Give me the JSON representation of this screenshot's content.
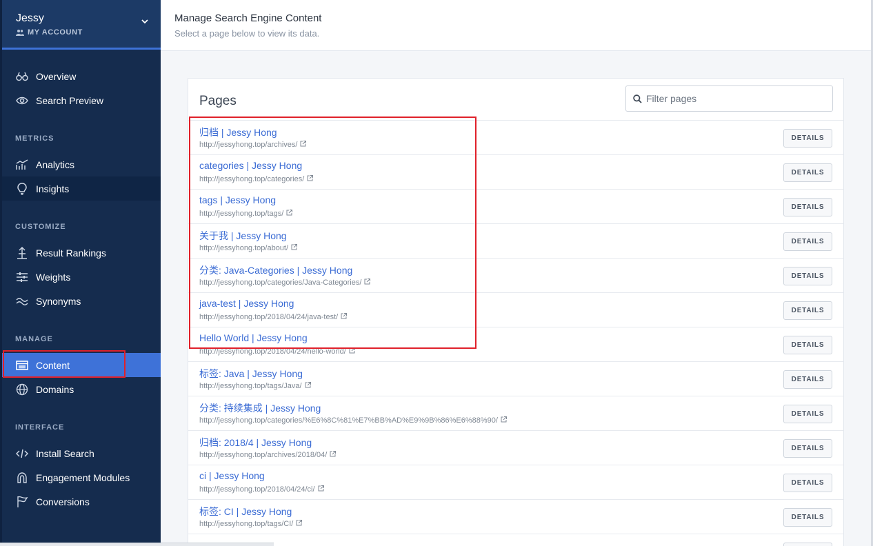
{
  "account": {
    "name": "Jessy",
    "label": "MY ACCOUNT"
  },
  "nav": {
    "overview": "Overview",
    "search_preview": "Search Preview",
    "metrics_header": "METRICS",
    "analytics": "Analytics",
    "insights": "Insights",
    "customize_header": "CUSTOMIZE",
    "result_rankings": "Result Rankings",
    "weights": "Weights",
    "synonyms": "Synonyms",
    "manage_header": "MANAGE",
    "content": "Content",
    "domains": "Domains",
    "interface_header": "INTERFACE",
    "install_search": "Install Search",
    "engagement_modules": "Engagement Modules",
    "conversions": "Conversions"
  },
  "header": {
    "title": "Manage Search Engine Content",
    "subtitle": "Select a page below to view its data."
  },
  "pages": {
    "title": "Pages",
    "filter_placeholder": "Filter pages",
    "details_label": "DETAILS",
    "rows": [
      {
        "title": "归档 | Jessy Hong",
        "url": "http://jessyhong.top/archives/"
      },
      {
        "title": "categories | Jessy Hong",
        "url": "http://jessyhong.top/categories/"
      },
      {
        "title": "tags | Jessy Hong",
        "url": "http://jessyhong.top/tags/"
      },
      {
        "title": "关于我 | Jessy Hong",
        "url": "http://jessyhong.top/about/"
      },
      {
        "title": "分类: Java-Categories | Jessy Hong",
        "url": "http://jessyhong.top/categories/Java-Categories/"
      },
      {
        "title": "java-test | Jessy Hong",
        "url": "http://jessyhong.top/2018/04/24/java-test/"
      },
      {
        "title": "Hello World | Jessy Hong",
        "url": "http://jessyhong.top/2018/04/24/hello-world/"
      },
      {
        "title": "标签: Java | Jessy Hong",
        "url": "http://jessyhong.top/tags/Java/"
      },
      {
        "title": "分类: 持续集成 | Jessy Hong",
        "url": "http://jessyhong.top/categories/%E6%8C%81%E7%BB%AD%E9%9B%86%E6%88%90/"
      },
      {
        "title": "归档: 2018/4 | Jessy Hong",
        "url": "http://jessyhong.top/archives/2018/04/"
      },
      {
        "title": "ci | Jessy Hong",
        "url": "http://jessyhong.top/2018/04/24/ci/"
      },
      {
        "title": "标签: CI | Jessy Hong",
        "url": "http://jessyhong.top/tags/CI/"
      },
      {
        "title": "...",
        "url": ""
      }
    ]
  }
}
